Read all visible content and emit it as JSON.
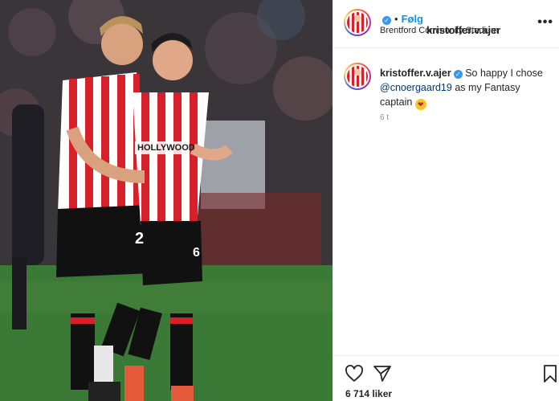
{
  "post": {
    "username": "kristoffer.v.ajer",
    "verified_mark": "✓",
    "dot": "•",
    "follow_label": "Følg",
    "location": "Brentford Community Stadium",
    "more_label": "•••"
  },
  "caption": {
    "username": "kristoffer.v.ajer",
    "text_before": "So happy I chose ",
    "mention": "@cnoergaard19",
    "text_after": " as my Fantasy captain ",
    "emoji": "❤",
    "timestamp": "6 t"
  },
  "actions": {
    "like_icon": "heart-icon",
    "share_icon": "paper-plane-icon",
    "save_icon": "bookmark-icon",
    "likes_count": "6 714 liker"
  },
  "photo": {
    "jersey_sponsor": "HOLLYWOOD",
    "jersey_number_left": "2",
    "jersey_number_right": "6"
  },
  "colors": {
    "accent": "#0095f6",
    "verified": "#3897f0",
    "stripe_red": "#d8202b",
    "pitch": "#3a7a36"
  }
}
